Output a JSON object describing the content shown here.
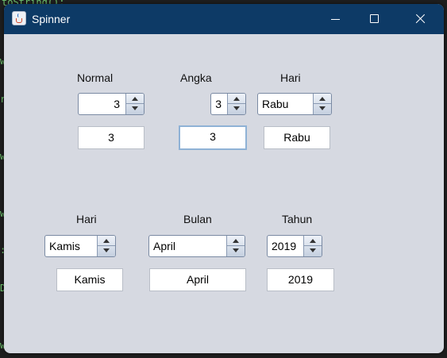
{
  "window": {
    "title": "Spinner"
  },
  "background_code": [
    "toString();",
    "w",
    "r",
    "w",
    "w",
    ":",
    "D",
    "w"
  ],
  "top_row": {
    "normal": {
      "label": "Normal",
      "spinner_value": "3",
      "field_value": "3"
    },
    "angka": {
      "label": "Angka",
      "spinner_value": "3",
      "field_value": "3"
    },
    "hari": {
      "label": "Hari",
      "spinner_value": "Rabu",
      "field_value": "Rabu"
    }
  },
  "bottom_row": {
    "hari": {
      "label": "Hari",
      "spinner_value": "Kamis",
      "field_value": "Kamis"
    },
    "bulan": {
      "label": "Bulan",
      "spinner_value": "April",
      "field_value": "April"
    },
    "tahun": {
      "label": "Tahun",
      "spinner_value": "2019",
      "field_value": "2019"
    }
  },
  "colors": {
    "titlebar": "#0d3a66",
    "window_bg": "#d6d9e1",
    "focus_border": "#8fb2d6"
  }
}
